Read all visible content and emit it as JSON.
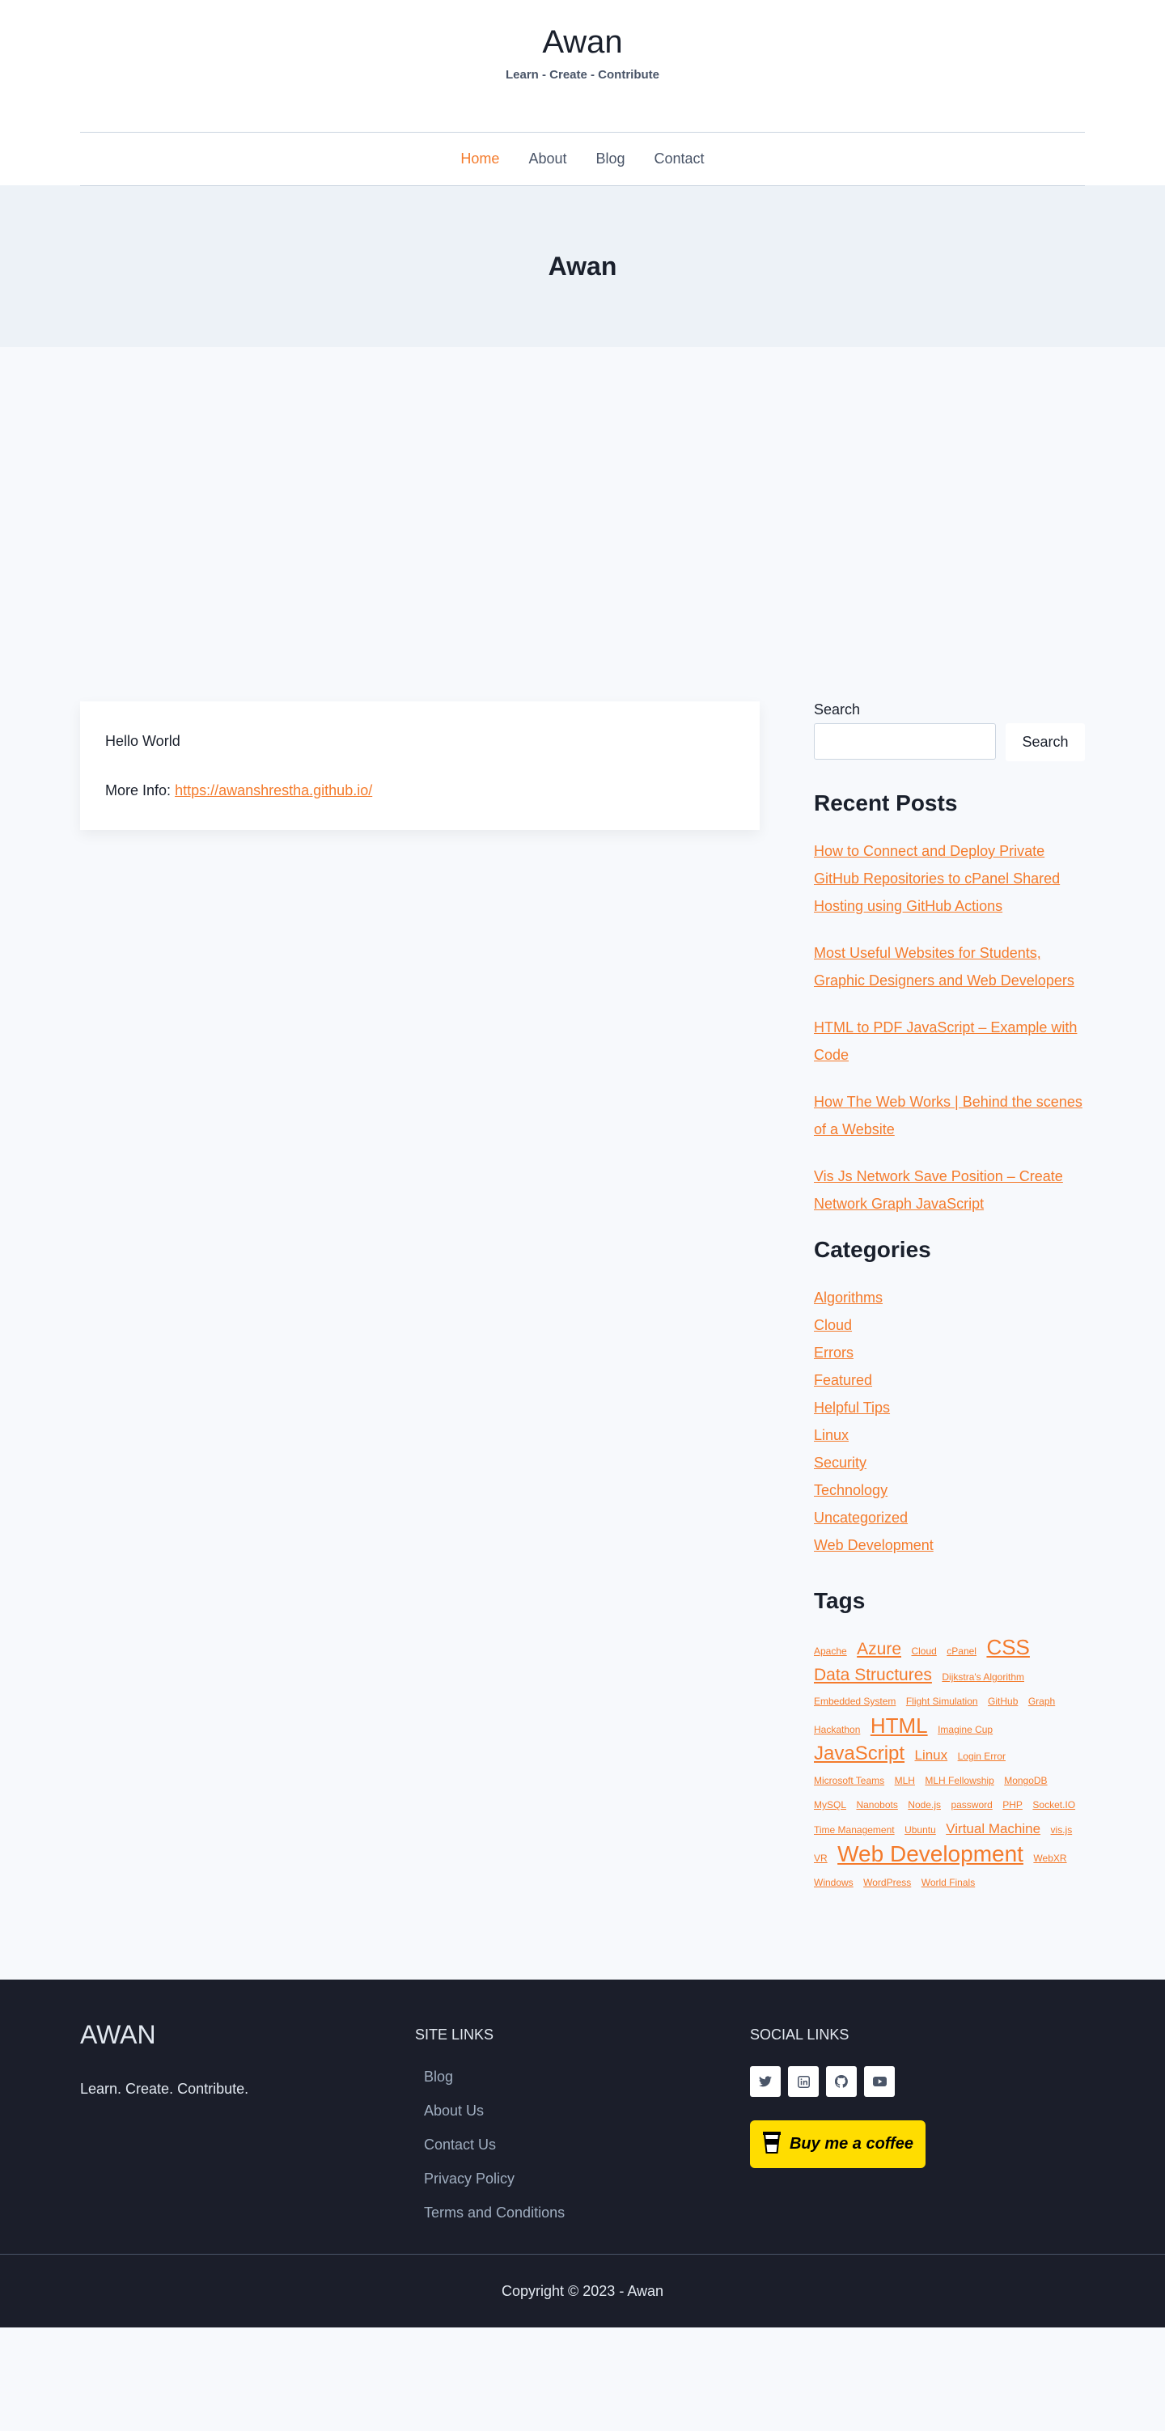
{
  "site": {
    "title": "Awan",
    "tagline": "Learn - Create - Contribute"
  },
  "nav": {
    "items": [
      {
        "label": "Home"
      },
      {
        "label": "About"
      },
      {
        "label": "Blog"
      },
      {
        "label": "Contact"
      }
    ]
  },
  "hero": {
    "title": "Awan"
  },
  "post": {
    "body": "Hello World",
    "more_label": "More Info:",
    "more_link": "https://awanshrestha.github.io/"
  },
  "sidebar": {
    "search_label": "Search",
    "search_button": "Search",
    "search_placeholder": "",
    "recent_title": "Recent Posts",
    "recent": [
      "How to Connect and Deploy Private GitHub Repositories to cPanel Shared Hosting using GitHub Actions",
      "Most Useful Websites for Students, Graphic Designers and Web Developers",
      "HTML to PDF JavaScript – Example with Code",
      "How The Web Works | Behind the scenes of a Website",
      "Vis Js Network Save Position – Create Network Graph JavaScript"
    ],
    "categories_title": "Categories",
    "categories": [
      "Algorithms",
      "Cloud",
      "Errors",
      "Featured",
      "Helpful Tips",
      "Linux",
      "Security",
      "Technology",
      "Uncategorized",
      "Web Development"
    ],
    "tags_title": "Tags",
    "tags": [
      {
        "label": "Apache",
        "size": 12
      },
      {
        "label": "Azure",
        "size": 21
      },
      {
        "label": "Cloud",
        "size": 12
      },
      {
        "label": "cPanel",
        "size": 12
      },
      {
        "label": "CSS",
        "size": 26
      },
      {
        "label": "Data Structures",
        "size": 21
      },
      {
        "label": "Dijkstra's Algorithm",
        "size": 12
      },
      {
        "label": "Embedded System",
        "size": 12
      },
      {
        "label": "Flight Simulation",
        "size": 12
      },
      {
        "label": "GitHub",
        "size": 12
      },
      {
        "label": "Graph",
        "size": 12
      },
      {
        "label": "Hackathon",
        "size": 12
      },
      {
        "label": "HTML",
        "size": 26
      },
      {
        "label": "Imagine Cup",
        "size": 12
      },
      {
        "label": "JavaScript",
        "size": 24
      },
      {
        "label": "Linux",
        "size": 17
      },
      {
        "label": "Login Error",
        "size": 12
      },
      {
        "label": "Microsoft Teams",
        "size": 12
      },
      {
        "label": "MLH",
        "size": 12
      },
      {
        "label": "MLH Fellowship",
        "size": 12
      },
      {
        "label": "MongoDB",
        "size": 12
      },
      {
        "label": "MySQL",
        "size": 12
      },
      {
        "label": "Nanobots",
        "size": 12
      },
      {
        "label": "Node.js",
        "size": 12
      },
      {
        "label": "password",
        "size": 12
      },
      {
        "label": "PHP",
        "size": 12
      },
      {
        "label": "Socket.IO",
        "size": 12
      },
      {
        "label": "Time Management",
        "size": 12
      },
      {
        "label": "Ubuntu",
        "size": 12
      },
      {
        "label": "Virtual Machine",
        "size": 17
      },
      {
        "label": "vis.js",
        "size": 12
      },
      {
        "label": "VR",
        "size": 12
      },
      {
        "label": "Web Development",
        "size": 28
      },
      {
        "label": "WebXR",
        "size": 12
      },
      {
        "label": "Windows",
        "size": 12
      },
      {
        "label": "WordPress",
        "size": 12
      },
      {
        "label": "World Finals",
        "size": 12
      }
    ]
  },
  "footer": {
    "logo": "AWAN",
    "description": "Learn. Create. Contribute.",
    "site_links_title": "SITE LINKS",
    "site_links": [
      "Blog",
      "About Us",
      "Contact Us",
      "Privacy Policy",
      "Terms and Conditions"
    ],
    "social_title": "SOCIAL LINKS",
    "social": [
      "twitter-icon",
      "linkedin-icon",
      "github-icon",
      "youtube-icon"
    ],
    "bmc_label": "Buy me a coffee",
    "copyright": "Copyright © 2023 -  Awan"
  },
  "colors": {
    "accent": "#f47b2c",
    "footer_bg": "#1b1e2a",
    "bmc_yellow": "#ffdd00"
  }
}
